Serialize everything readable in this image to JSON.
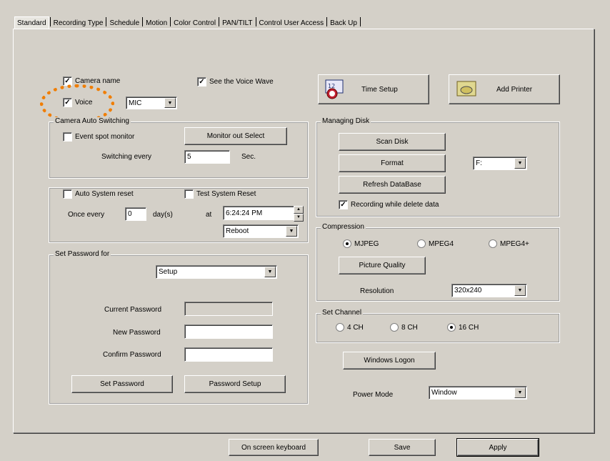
{
  "tabs": [
    "Standard",
    "Recording Type",
    "Schedule",
    "Motion",
    "Color Control",
    "PAN/TILT",
    "Control User Access",
    "Back Up"
  ],
  "top": {
    "camera_name": "Camera name",
    "voice": "Voice",
    "voice_mode": "MIC",
    "see_wave": "See the Voice Wave",
    "time_setup": "Time Setup",
    "add_printer": "Add Printer"
  },
  "camera_auto": {
    "title": "Camera Auto Switching",
    "event_spot": "Event spot monitor",
    "monitor_out": "Monitor out Select",
    "switching_every": "Switching every",
    "switching_value": "5",
    "sec": "Sec."
  },
  "reset": {
    "auto_reset": "Auto System reset",
    "test_reset": "Test System Reset",
    "once_every": "Once every",
    "once_value": "0",
    "days": "day(s)",
    "at": "at",
    "time": "6:24:24 PM",
    "action": "Reboot"
  },
  "password": {
    "title": "Set Password for",
    "target": "Setup",
    "current": "Current Password",
    "new": "New Password",
    "confirm": "Confirm Password",
    "set_btn": "Set Password",
    "setup_btn": "Password Setup"
  },
  "disk": {
    "title": "Managing Disk",
    "scan": "Scan Disk",
    "format": "Format",
    "drive": "F:",
    "refresh": "Refresh DataBase",
    "rec_delete": "Recording while delete data"
  },
  "compression": {
    "title": "Compression",
    "mjpeg": "MJPEG",
    "mpeg4": "MPEG4",
    "mpeg4plus": "MPEG4+",
    "quality": "Picture Quality",
    "resolution_label": "Resolution",
    "resolution": "320x240"
  },
  "channel": {
    "title": "Set Channel",
    "ch4": "4 CH",
    "ch8": "8 CH",
    "ch16": "16 CH"
  },
  "windows_logon": "Windows Logon",
  "power_mode_label": "Power Mode",
  "power_mode": "Window",
  "bottom": {
    "keyboard": "On screen keyboard",
    "save": "Save",
    "apply": "Apply"
  },
  "icons": {
    "check": "✓",
    "arrow": "▼",
    "up": "▲",
    "down": "▼"
  }
}
